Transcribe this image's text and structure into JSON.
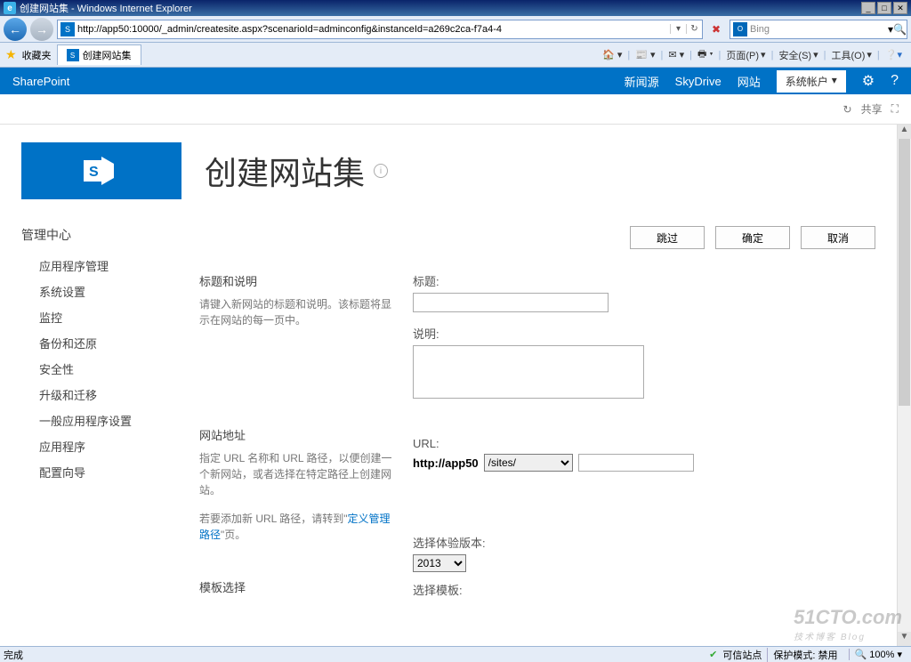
{
  "window": {
    "title": "创建网站集 - Windows Internet Explorer",
    "url": "http://app50:10000/_admin/createsite.aspx?scenarioId=adminconfig&instanceId=a269c2ca-f7a4-4",
    "search_placeholder": "Bing"
  },
  "favbar": {
    "label": "收藏夹",
    "tab": "创建网站集"
  },
  "cmdbar": {
    "page": "页面(P)",
    "safety": "安全(S)",
    "tools": "工具(O)"
  },
  "suite": {
    "brand": "SharePoint",
    "newsfeed": "新闻源",
    "skydrive": "SkyDrive",
    "sites": "网站",
    "account": "系统帐户",
    "share": "共享"
  },
  "page": {
    "title": "创建网站集"
  },
  "sidebar": {
    "heading": "管理中心",
    "items": [
      "应用程序管理",
      "系统设置",
      "监控",
      "备份和还原",
      "安全性",
      "升级和迁移",
      "一般应用程序设置",
      "应用程序",
      "配置向导"
    ]
  },
  "buttons": {
    "skip": "跳过",
    "ok": "确定",
    "cancel": "取消"
  },
  "sec1": {
    "h": "标题和说明",
    "d": "请键入新网站的标题和说明。该标题将显示在网站的每一页中。",
    "title_lbl": "标题:",
    "desc_lbl": "说明:"
  },
  "sec2": {
    "h": "网站地址",
    "d1": "指定 URL 名称和 URL 路径，以便创建一个新网站，或者选择在特定路径上创建网站。",
    "d2a": "若要添加新 URL 路径，请转到\"",
    "d2link": "定义管理路径",
    "d2b": "\"页。",
    "url_lbl": "URL:",
    "host": "http://app50",
    "path": "/sites/"
  },
  "sec3": {
    "h": "模板选择",
    "ver_lbl": "选择体验版本:",
    "ver": "2013",
    "tpl_lbl": "选择模板:"
  },
  "status": {
    "done": "完成",
    "trusted": "可信站点",
    "protected": "保护模式: 禁用",
    "zoom": "100%"
  },
  "watermark": {
    "a": "51CTO.com",
    "b": "技术博客  Blog"
  }
}
